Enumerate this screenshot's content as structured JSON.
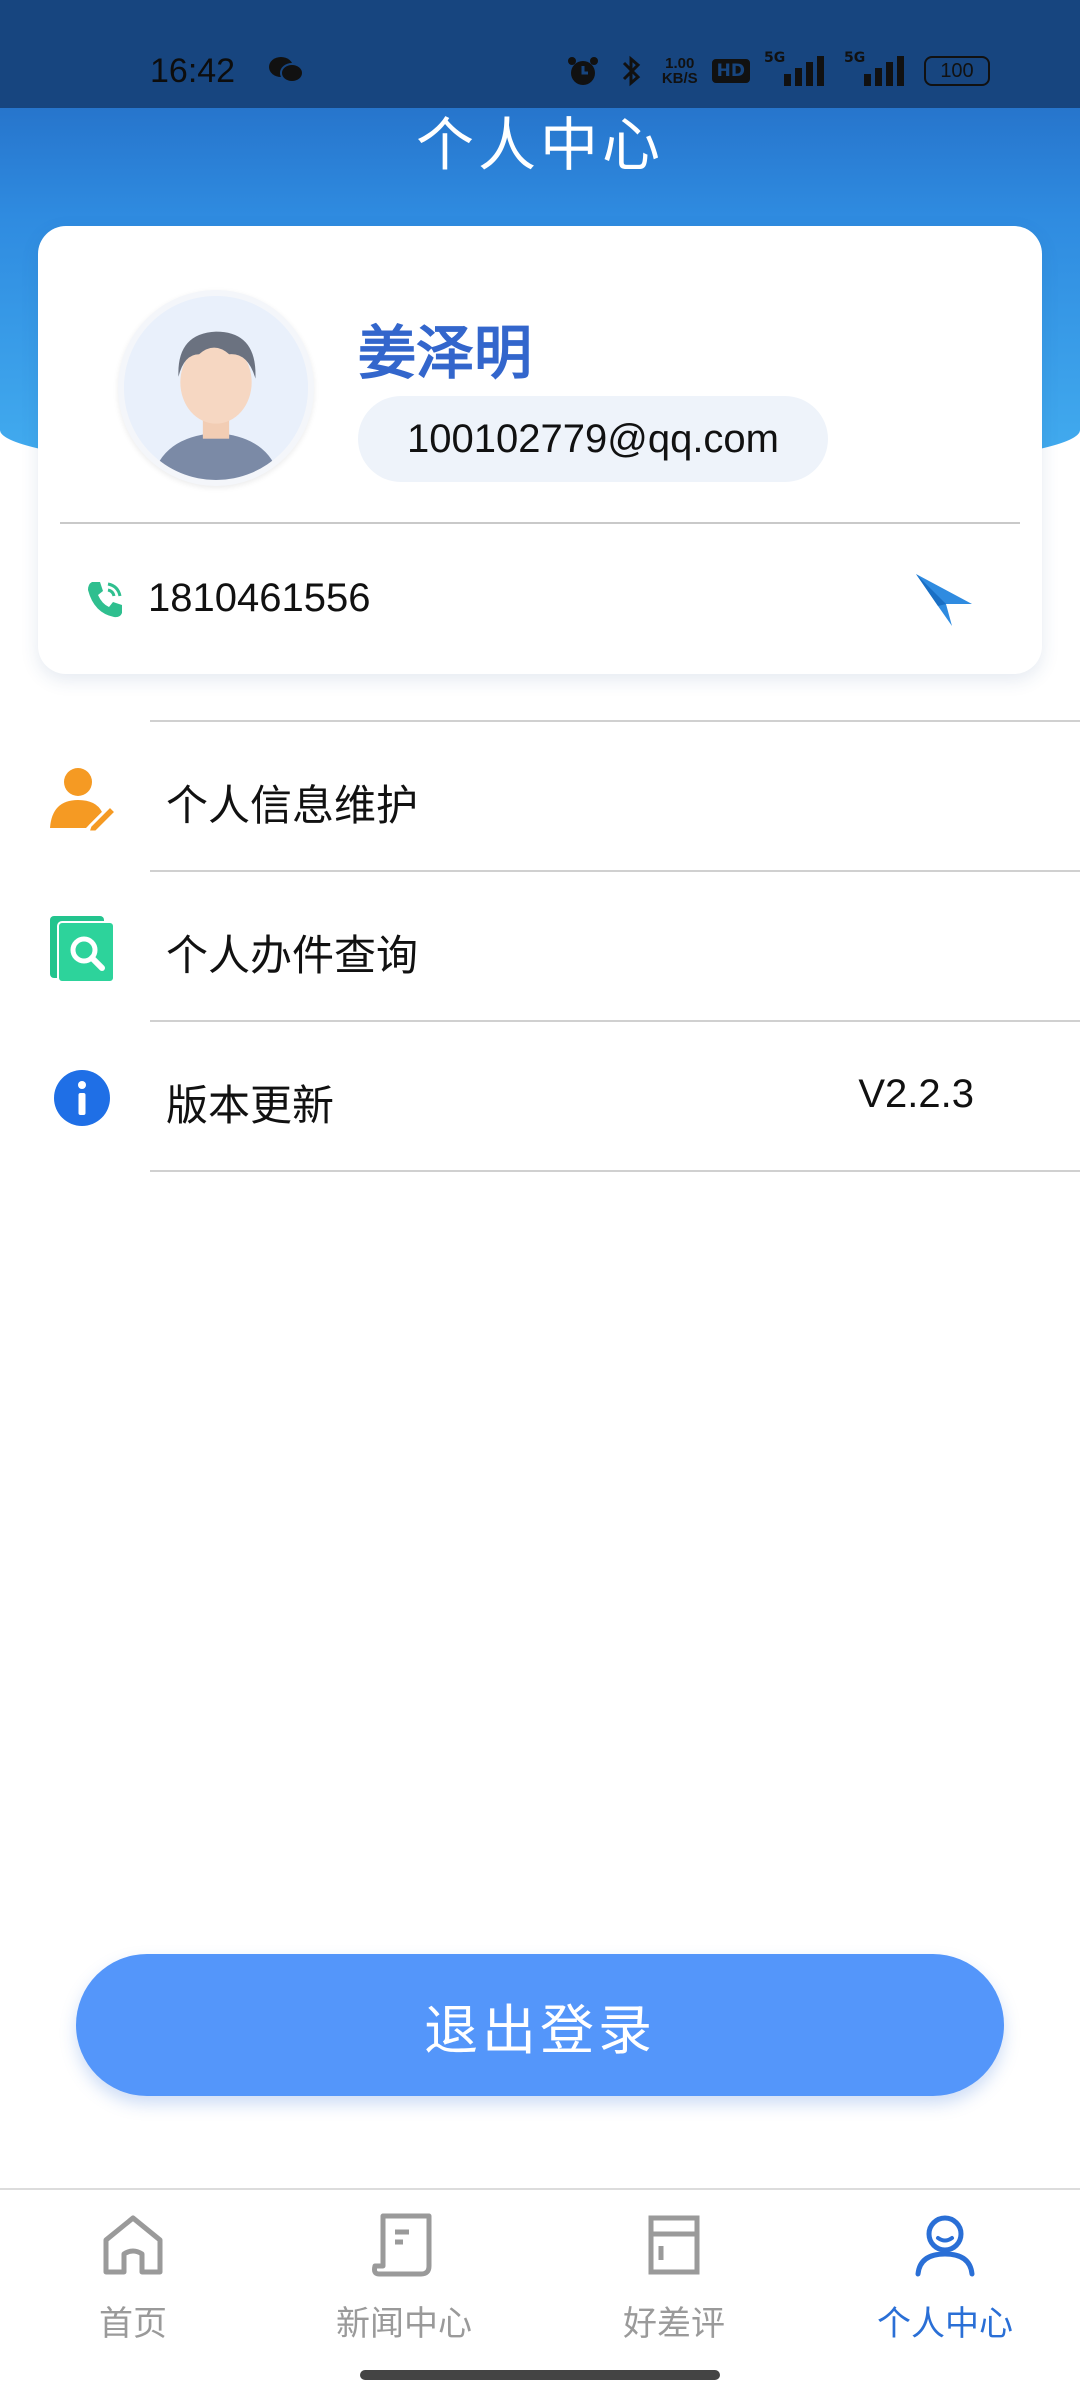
{
  "status_bar": {
    "time": "16:42",
    "net_speed_value": "1.00",
    "net_speed_unit": "KB/S",
    "hd_label": "HD",
    "network_1": "5G",
    "network_2": "5G",
    "battery": "100",
    "icons": [
      "wechat-icon",
      "alarm-icon",
      "bluetooth-icon",
      "signal-icon",
      "battery-icon"
    ]
  },
  "header": {
    "title": "个人中心"
  },
  "profile": {
    "name": "姜泽明",
    "email": "100102779@qq.com",
    "phone": "1810461556"
  },
  "menu": {
    "items": [
      {
        "label": "个人信息维护",
        "icon": "user-edit-icon"
      },
      {
        "label": "个人办件查询",
        "icon": "document-search-icon"
      },
      {
        "label": "版本更新",
        "icon": "info-icon",
        "value": "V2.2.3"
      }
    ]
  },
  "logout": {
    "label": "退出登录"
  },
  "bottom_nav": {
    "items": [
      {
        "label": "首页",
        "icon": "home-icon",
        "active": false
      },
      {
        "label": "新闻中心",
        "icon": "news-icon",
        "active": false
      },
      {
        "label": "好差评",
        "icon": "review-icon",
        "active": false
      },
      {
        "label": "个人中心",
        "icon": "profile-icon",
        "active": true
      }
    ]
  },
  "colors": {
    "header_gradient_top": "#1e5fb8",
    "header_gradient_bottom": "#43aef0",
    "accent": "#3366cc",
    "logout_button": "#5496fa",
    "nav_active": "#2a6fd6",
    "nav_inactive": "#9a9a9a"
  }
}
